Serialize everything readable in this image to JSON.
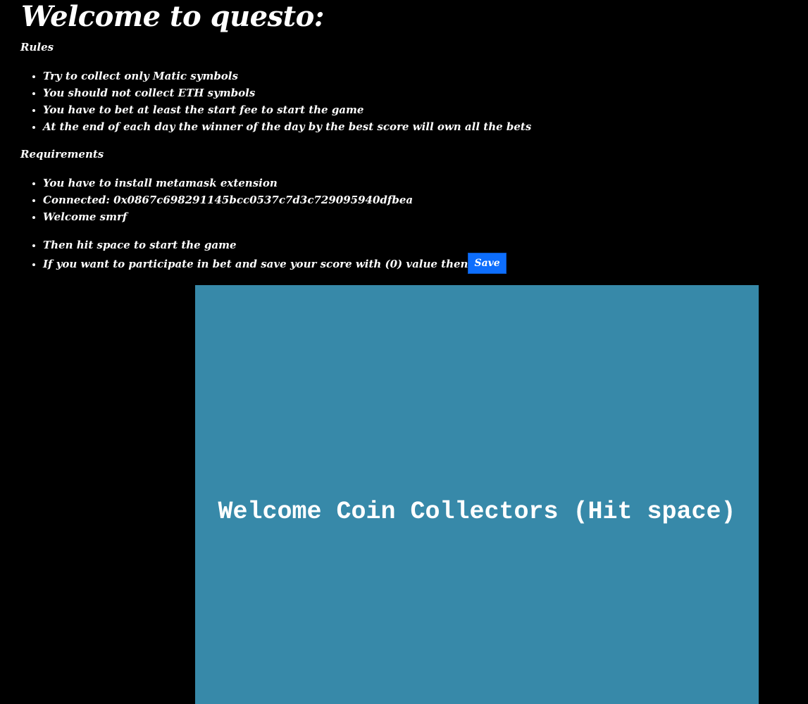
{
  "page": {
    "title": "Welcome to questo:"
  },
  "rules": {
    "label": "Rules",
    "items": [
      "Try to collect only Matic symbols",
      "You should not collect ETH symbols",
      "You have to bet at least the start fee to start the game",
      "At the end of each day the winner of the day by the best score will own all the bets"
    ]
  },
  "requirements": {
    "label": "Requirements",
    "items": [
      "You have to install metamask extension",
      "Connected: 0x0867c698291145bcc0537c7d3c729095940dfbea",
      "Welcome smrf"
    ]
  },
  "actions": {
    "start_text": "Then hit space to start the game",
    "save_text": "If you want to participate in bet and save your score with (0) value then",
    "save_label": "Save"
  },
  "game": {
    "message": "Welcome Coin Collectors (Hit space)",
    "background_color": "#3789a9"
  },
  "colors": {
    "page_background": "#000000",
    "text": "#ffffff",
    "save_button": "#0d6efd"
  }
}
